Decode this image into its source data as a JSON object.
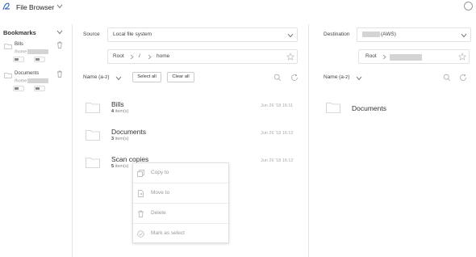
{
  "app": {
    "title": "File Browser"
  },
  "bookmarks": {
    "title": "Bookmarks",
    "items": [
      {
        "name": "Bills",
        "path": "/home"
      },
      {
        "name": "Documents",
        "path": "/home"
      }
    ]
  },
  "source": {
    "label": "Source",
    "selected": "Local file system",
    "breadcrumb": [
      "Root",
      "/",
      "home"
    ],
    "sort_label": "Name (a-z)",
    "select_all_label": "Select all",
    "clear_all_label": "Clear all",
    "items": [
      {
        "name": "Bills",
        "count": "4",
        "count_suffix": " item(s)",
        "date": "Jun 26 '18 16:11"
      },
      {
        "name": "Documents",
        "count": "3",
        "count_suffix": " item(s)",
        "date": "Jun 26 '18 16:12"
      },
      {
        "name": "Scan copies",
        "count": "5",
        "count_suffix": " item(s)",
        "date": "Jun 26 '18 16:12"
      }
    ]
  },
  "destination": {
    "label": "Destination",
    "selected_suffix": "(AWS)",
    "breadcrumb_root": "Root",
    "sort_label": "Name (a-z)",
    "items": [
      {
        "name": "Documents"
      }
    ]
  },
  "context_menu": {
    "items": [
      {
        "label": "Copy to",
        "icon": "copy-icon"
      },
      {
        "label": "Move to",
        "icon": "move-icon"
      },
      {
        "label": "Delete",
        "icon": "trash-icon"
      },
      {
        "label": "Mark as select",
        "icon": "check-circle-icon"
      }
    ]
  },
  "colors": {
    "folder": "#cfcfcf",
    "logo_accent": "#3a6fb0",
    "redaction": "#d4d4d4",
    "border": "#e2e2e2"
  }
}
